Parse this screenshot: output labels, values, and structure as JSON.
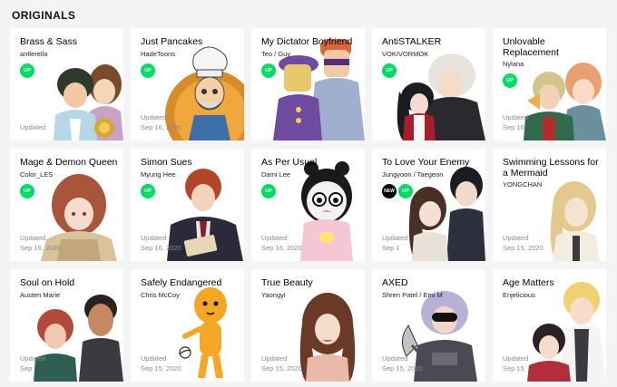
{
  "section": {
    "title": "ORIGINALS"
  },
  "colors": {
    "up_badge": "#00dc64",
    "new_badge": "#000000",
    "background": "#f4f4f4"
  },
  "cards": [
    {
      "title": "Brass & Sass",
      "author": "antlerella",
      "badges": [
        "UP"
      ],
      "updated_label": "Updated",
      "updated_date": "",
      "art": "brass-and-sass-artwork"
    },
    {
      "title": "Just Pancakes",
      "author": "HadeToons",
      "badges": [
        "UP"
      ],
      "updated_label": "Updated",
      "updated_date": "Sep 16, 2020",
      "art": "just-pancakes-artwork"
    },
    {
      "title": "My Dictator Boyfriend",
      "author": "Teo / Guy",
      "badges": [
        "UP"
      ],
      "updated_label": "",
      "updated_date": "",
      "art": "my-dictator-boyfriend-artwork"
    },
    {
      "title": "AntiSTALKER",
      "author": "VOKIVORMOK",
      "badges": [
        "UP"
      ],
      "updated_label": "",
      "updated_date": "",
      "art": "antistalker-artwork"
    },
    {
      "title": "Unlovable Replacement",
      "author": "Nylana",
      "badges": [
        "UP"
      ],
      "updated_label": "Updated",
      "updated_date": "Sep 16,",
      "art": "unlovable-replacement-artwork"
    },
    {
      "title": "Mage & Demon Queen",
      "author": "Color_LES",
      "badges": [
        "UP"
      ],
      "updated_label": "Updated",
      "updated_date": "Sep 16, 2020",
      "art": "mage-and-demon-queen-artwork"
    },
    {
      "title": "Simon Sues",
      "author": "Myung Hee",
      "badges": [
        "UP"
      ],
      "updated_label": "Updated",
      "updated_date": "Sep 16, 2020",
      "art": "simon-sues-artwork"
    },
    {
      "title": "As Per Usual",
      "author": "Dami Lee",
      "badges": [
        "UP"
      ],
      "updated_label": "Updated",
      "updated_date": "Sep 16, 2020",
      "art": "as-per-usual-artwork"
    },
    {
      "title": "To Love Your Enemy",
      "author": "Jungyoon / Taegeon",
      "badges": [
        "NEW",
        "UP"
      ],
      "updated_label": "Updated",
      "updated_date": "Sep 1",
      "art": "to-love-your-enemy-artwork"
    },
    {
      "title": "Swimming Lessons for a Mermaid",
      "author": "YONGCHAN",
      "badges": [],
      "updated_label": "Updated",
      "updated_date": "Sep 15, 2020",
      "art": "swimming-lessons-artwork"
    },
    {
      "title": "Soul on Hold",
      "author": "Austen Marie",
      "badges": [],
      "updated_label": "Updated",
      "updated_date": "Sep",
      "art": "soul-on-hold-artwork"
    },
    {
      "title": "Safely Endangered",
      "author": "Chris McCoy",
      "badges": [],
      "updated_label": "Updated",
      "updated_date": "Sep 15, 2020",
      "art": "safely-endangered-artwork"
    },
    {
      "title": "True Beauty",
      "author": "Yaongyi",
      "badges": [],
      "updated_label": "Updated",
      "updated_date": "Sep 15, 2020",
      "art": "true-beauty-artwork"
    },
    {
      "title": "AXED",
      "author": "Shren Patel / Emi M",
      "badges": [],
      "updated_label": "Updated",
      "updated_date": "Sep 15, 2020",
      "art": "axed-artwork"
    },
    {
      "title": "Age Matters",
      "author": "Enjelicious",
      "badges": [],
      "updated_label": "Updated",
      "updated_date": "Sep 15",
      "art": "age-matters-artwork"
    }
  ]
}
